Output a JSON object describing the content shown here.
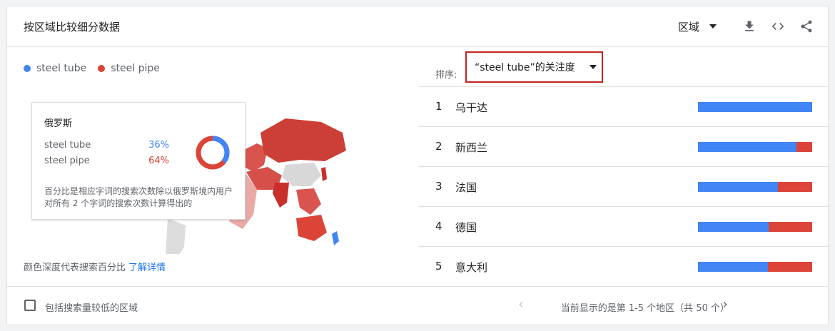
{
  "header": {
    "title": "按区域比较细分数据",
    "region_label": "区域",
    "icons": [
      "download-icon",
      "embed-code-icon",
      "share-icon"
    ]
  },
  "legend": [
    {
      "label": "steel tube",
      "color": "#4285f4"
    },
    {
      "label": "steel pipe",
      "color": "#db4437"
    }
  ],
  "tooltip": {
    "country": "俄罗斯",
    "rows": [
      {
        "term": "steel tube",
        "pct": "36%",
        "color": "#4285f4"
      },
      {
        "term": "steel pipe",
        "pct": "64%",
        "color": "#db4437"
      }
    ],
    "donut_share_blue": 0.36,
    "note": "百分比是相应字词的搜索次数除以俄罗斯境内用户对所有 2 个字词的搜索次数计算得出的"
  },
  "footnote": {
    "text": "颜色深度代表搜索百分比",
    "link": "了解详情"
  },
  "sort": {
    "label": "排序:",
    "value": "“steel tube”的关注度"
  },
  "ranking": [
    {
      "rank": "1",
      "name": "乌干达",
      "blue_share": 1.0
    },
    {
      "rank": "2",
      "name": "新西兰",
      "blue_share": 0.86
    },
    {
      "rank": "3",
      "name": "法国",
      "blue_share": 0.7
    },
    {
      "rank": "4",
      "name": "德国",
      "blue_share": 0.62
    },
    {
      "rank": "5",
      "name": "意大利",
      "blue_share": 0.61
    }
  ],
  "footer": {
    "checkbox_label": "包括搜索量较低的区域",
    "pager_text": "当前显示的是第 1-5 个地区（共 50 个）"
  }
}
